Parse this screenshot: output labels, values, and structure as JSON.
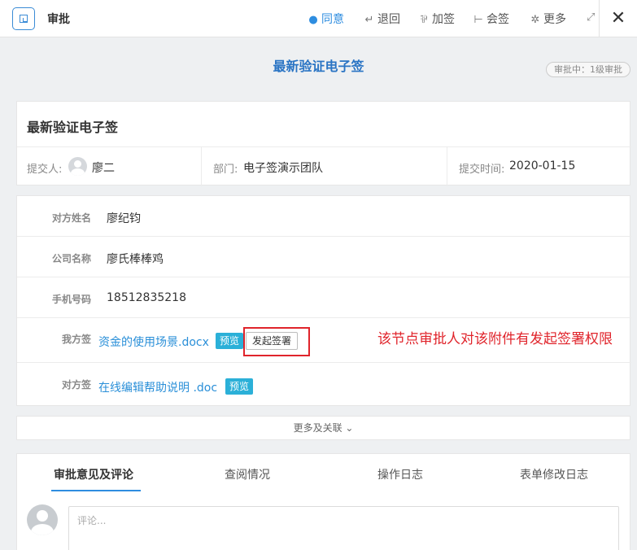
{
  "toolbar": {
    "title": "审批",
    "agree": "同意",
    "return": "退回",
    "add_sign": "加签",
    "co_sign": "会签",
    "more": "更多",
    "close": "✕",
    "icons": {
      "agree": "check-circle-icon",
      "return": "return-arrow-icon",
      "add_sign": "add-sign-icon",
      "co_sign": "co-sign-icon",
      "more": "gear-icon",
      "expand": "expand-icon"
    }
  },
  "header": {
    "heading": "最新验证电子签",
    "status": "审批中：1级审批"
  },
  "summary": {
    "title": "最新验证电子签",
    "submitter_label": "提交人:",
    "submitter_name": "廖二",
    "dept_label": "部门:",
    "dept_value": "电子签演示团队",
    "time_label": "提交时间:",
    "time_value": "2020-01-15"
  },
  "fields": {
    "counterparty_name_label": "对方姓名",
    "counterparty_name_value": "廖纪钧",
    "company_label": "公司名称",
    "company_value": "廖氏棒棒鸡",
    "phone_label": "手机号码",
    "phone_value": "18512835218",
    "our_sign_label": "我方签",
    "our_sign_file": "资金的使用场景.docx",
    "preview_label": "预览",
    "initiate_sign_label": "发起签署",
    "their_sign_label": "对方签",
    "their_sign_file": "在线编辑帮助说明 .doc",
    "preview_label_2": "预览"
  },
  "annotation": "该节点审批人对该附件有发起签署权限",
  "more_link": "更多及关联 ⌄",
  "tabs": [
    "审批意见及评论",
    "查阅情况",
    "操作日志",
    "表单修改日志"
  ],
  "comment": {
    "placeholder": "评论..."
  },
  "colors": {
    "accent": "#2e8de0",
    "annotation": "#e0242b",
    "tag": "#2bb0d8"
  }
}
